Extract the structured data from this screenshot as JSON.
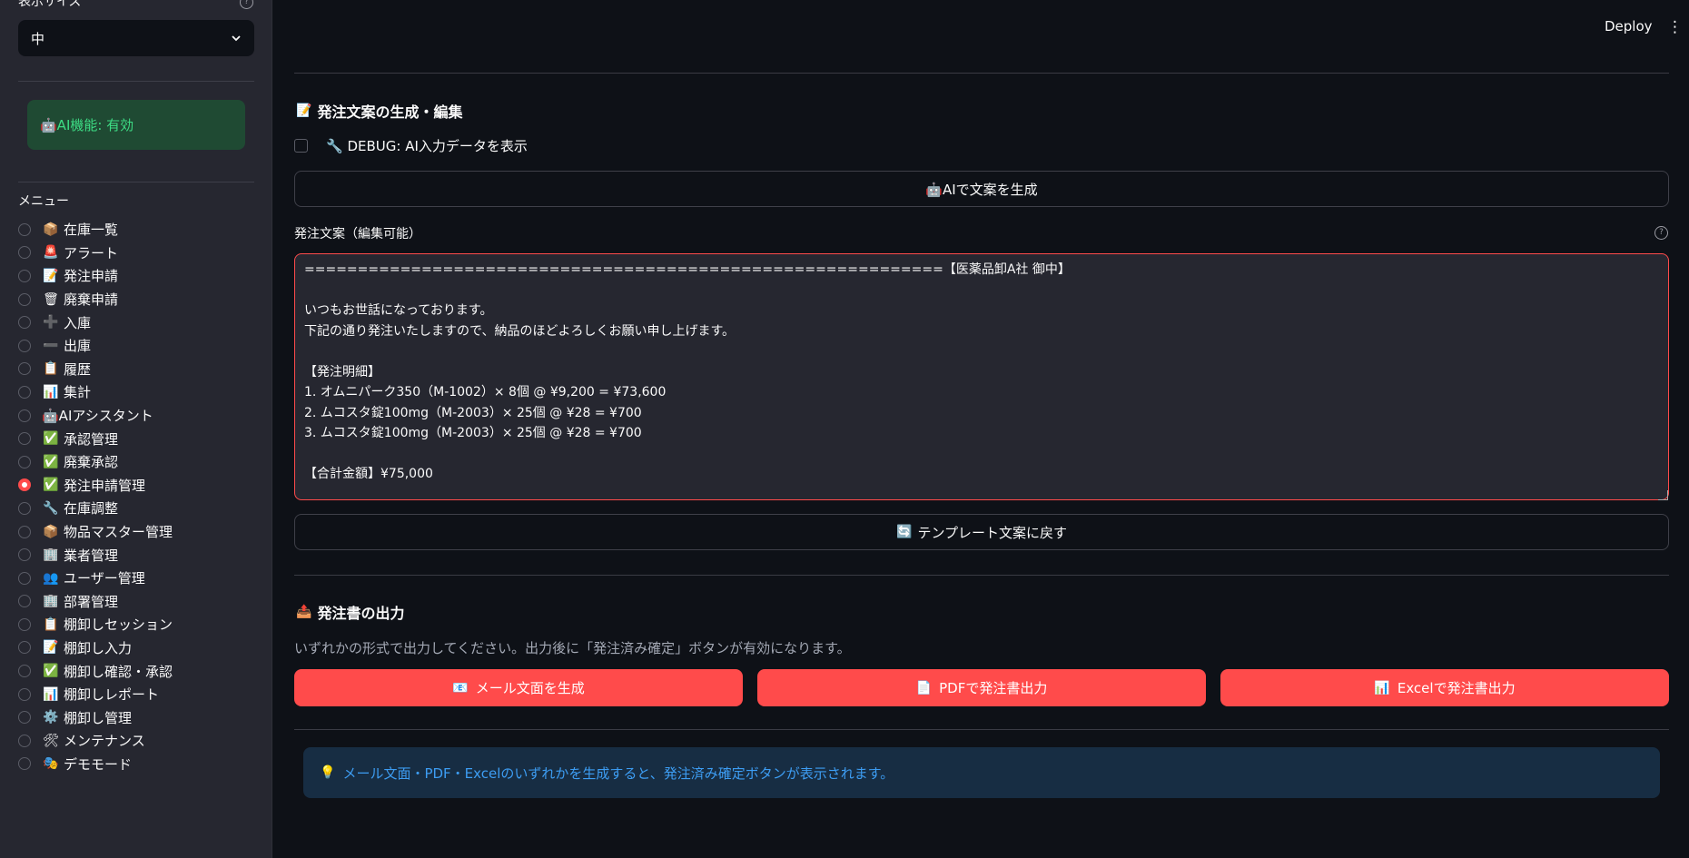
{
  "sidebar": {
    "size_label": "表示サイズ",
    "size_select": {
      "value": "中"
    },
    "ai_status": "🤖AI機能: 有効",
    "menu_title": "メニュー",
    "menu_items": [
      {
        "icon": "📦",
        "label": "在庫一覧",
        "selected": false
      },
      {
        "icon": "🚨",
        "label": "アラート",
        "selected": false
      },
      {
        "icon": "📝",
        "label": "発注申請",
        "selected": false
      },
      {
        "icon": "🗑",
        "label": "廃棄申請",
        "selected": false
      },
      {
        "icon": "➕",
        "label": "入庫",
        "selected": false
      },
      {
        "icon": "➖",
        "label": "出庫",
        "selected": false
      },
      {
        "icon": "📋",
        "label": "履歴",
        "selected": false
      },
      {
        "icon": "📊",
        "label": "集計",
        "selected": false
      },
      {
        "icon": "",
        "label": "🤖AIアシスタント",
        "selected": false
      },
      {
        "icon": "✅",
        "label": "承認管理",
        "selected": false
      },
      {
        "icon": "✅",
        "label": "廃棄承認",
        "selected": false
      },
      {
        "icon": "✅",
        "label": "発注申請管理",
        "selected": true
      },
      {
        "icon": "🔧",
        "label": "在庫調整",
        "selected": false
      },
      {
        "icon": "📦",
        "label": "物品マスター管理",
        "selected": false
      },
      {
        "icon": "🏢",
        "label": "業者管理",
        "selected": false
      },
      {
        "icon": "👥",
        "label": "ユーザー管理",
        "selected": false
      },
      {
        "icon": "🏢",
        "label": "部署管理",
        "selected": false
      },
      {
        "icon": "📋",
        "label": "棚卸しセッション",
        "selected": false
      },
      {
        "icon": "📝",
        "label": "棚卸し入力",
        "selected": false
      },
      {
        "icon": "✅",
        "label": "棚卸し確認・承認",
        "selected": false
      },
      {
        "icon": "📊",
        "label": "棚卸しレポート",
        "selected": false
      },
      {
        "icon": "⚙️",
        "label": "棚卸し管理",
        "selected": false
      },
      {
        "icon": "🛠",
        "label": "メンテナンス",
        "selected": false
      },
      {
        "icon": "🎭",
        "label": "デモモード",
        "selected": false
      }
    ]
  },
  "header": {
    "deploy_label": "Deploy",
    "menu_icon": "⋮"
  },
  "main": {
    "edit_section_title": "発注文案の生成・編集",
    "debug_checkbox_label": "🔧 DEBUG: AI入力データを表示",
    "generate_button_label": "🤖AIで文案を生成",
    "textarea_label": "発注文案（編集可能）",
    "textarea_value": "============================================================【医薬品卸A社 御中】\n\nいつもお世話になっております。\n下記の通り発注いたしますので、納品のほどよろしくお願い申し上げます。\n\n【発注明細】\n1. オムニパーク350（M-1002）× 8個 @ ¥9,200 = ¥73,600\n2. ムコスタ錠100mg（M-2003）× 25個 @ ¥28 = ¥700\n3. ムコスタ錠100mg（M-2003）× 25個 @ ¥28 = ¥700\n\n【合計金額】¥75,000",
    "reset_button_label": "テンプレート文案に戻す",
    "output_section_title": "発注書の出力",
    "output_caption": "いずれかの形式で出力してください。出力後に「発注済み確定」ボタンが有効になります。",
    "output_buttons": [
      {
        "icon": "📧",
        "label": "メール文面を生成"
      },
      {
        "icon": "📄",
        "label": "PDFで発注書出力"
      },
      {
        "icon": "📊",
        "label": "Excelで発注書出力"
      }
    ],
    "info_message": "メール文面・PDF・Excelのいずれかを生成すると、発注済み確定ボタンが表示されます。"
  }
}
